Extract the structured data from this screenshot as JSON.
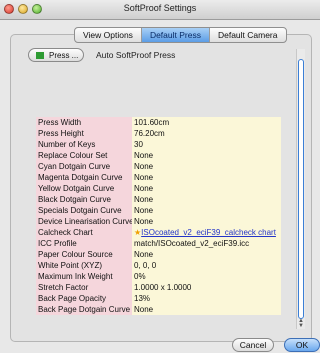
{
  "window": {
    "title": "SoftProof Settings"
  },
  "tabs": [
    {
      "label": "View Options",
      "active": false
    },
    {
      "label": "Default Press",
      "active": true
    },
    {
      "label": "Default Camera",
      "active": false
    }
  ],
  "press": {
    "button_label": "Press ...",
    "swatch_color": "#2e9b33",
    "auto_label": "Auto SoftProof Press"
  },
  "settings": [
    {
      "key": "Press Width",
      "value": "101.60cm"
    },
    {
      "key": "Press Height",
      "value": "76.20cm"
    },
    {
      "key": "Number of Keys",
      "value": "30"
    },
    {
      "key": "Replace Colour Set",
      "value": "None"
    },
    {
      "key": "Cyan Dotgain Curve",
      "value": "None"
    },
    {
      "key": "Magenta Dotgain Curve",
      "value": "None"
    },
    {
      "key": "Yellow Dotgain Curve",
      "value": "None"
    },
    {
      "key": "Black Dotgain Curve",
      "value": "None"
    },
    {
      "key": "Specials Dotgain Curve",
      "value": "None"
    },
    {
      "key": "Device Linearisation Curve",
      "value": "None"
    },
    {
      "key": "Calcheck Chart",
      "value": "ISOcoated_v2_eciF39_calcheck chart",
      "is_link": true
    },
    {
      "key": "ICC Profile",
      "value": "match/ISOcoated_v2_eciF39.icc"
    },
    {
      "key": "Paper Colour Source",
      "value": "None"
    },
    {
      "key": "White Point (XYZ)",
      "value": "0, 0, 0"
    },
    {
      "key": "Maximum Ink Weight",
      "value": "0%"
    },
    {
      "key": "Stretch Factor",
      "value": "1.0000 x 1.0000"
    },
    {
      "key": "Back Page Opacity",
      "value": "13%"
    },
    {
      "key": "Back Page Dotgain Curve",
      "value": "None"
    }
  ],
  "buttons": {
    "cancel": "Cancel",
    "ok": "OK"
  },
  "colors": {
    "key_bg": "#f5d6dc",
    "value_bg": "#fbf7d8",
    "accent": "#5c9de6",
    "link": "#2435c8"
  }
}
